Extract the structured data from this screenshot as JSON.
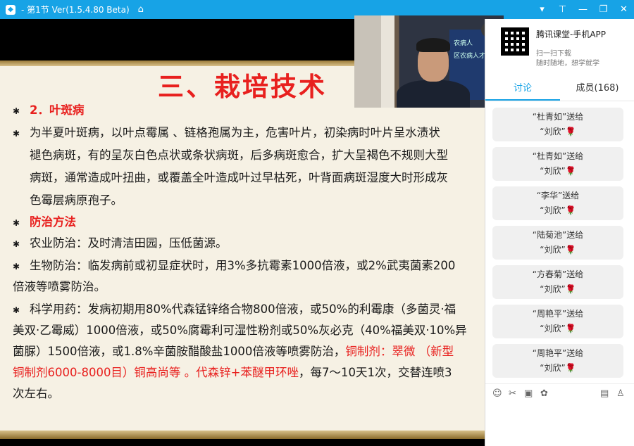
{
  "titlebar": {
    "title": "- 第1节 Ver(1.5.4.80 Beta)",
    "icons": [
      "app-icon",
      "home-icon",
      "dropdown-icon",
      "pin-icon",
      "restore-icon",
      "close-icon"
    ]
  },
  "slide": {
    "title": "三、栽培技术",
    "lines": [
      "2．叶斑病",
      "为半夏叶斑病，以叶点霉属 、链格孢属为主，危害叶片，初染病时叶片呈水渍状",
      "褪色病斑，有的呈灰白色点状或条状病斑，后多病斑愈合，扩大呈褐色不规则大型",
      "病斑，通常造成叶扭曲，或覆盖全叶造成叶过早枯死，叶背面病斑湿度大时形成灰",
      "色霉层病原孢子。",
      "防治方法",
      "农业防治：及时清洁田园，压低菌源。",
      "生物防治：临发病前或初显症状时，用3%多抗霉素1000倍液，或2%武夷菌素200",
      "倍液等喷雾防治。",
      "科学用药：发病初期用80%代森锰锌络合物800倍液，或50%的利霉康（多菌灵·福",
      "美双·乙霉威）1000倍液，或50%腐霉利可湿性粉剂或50%灰必克（40%福美双·10%异",
      "菌脲）1500倍液，或1.8%辛菌胺醋酸盐1000倍液等喷雾防治，",
      "铜制剂：翠微 （新型",
      "铜制剂6000-8000目）铜高尚等 。代森锌+苯醚甲环唑",
      "，每7～10天1次，交替连喷3",
      "次左右。"
    ]
  },
  "video": {
    "screen_text": [
      "农病人",
      "区农病人才"
    ]
  },
  "panel": {
    "promo_title": "腾讯课堂-手机APP",
    "promo_sub1": "扫一扫下载",
    "promo_sub2": "随时随地，想学就学",
    "tab_discuss": "讨论",
    "tab_members": "成员(168)",
    "messages": [
      {
        "line1": "“杜青如”送给",
        "line2": "“刘欣”"
      },
      {
        "line1": "“杜青如”送给",
        "line2": "“刘欣”"
      },
      {
        "line1": "“李华”送给",
        "line2": "“刘欣”"
      },
      {
        "line1": "“陆菊池”送给",
        "line2": "“刘欣”"
      },
      {
        "line1": "“方春菊”送给",
        "line2": "“刘欣”"
      },
      {
        "line1": "“周艳平”送给",
        "line2": "“刘欣”"
      },
      {
        "line1": "“周艳平”送给",
        "line2": "“刘欣”"
      }
    ]
  },
  "colors": {
    "accent": "#17a3e6",
    "slide_title": "#e8201e",
    "slide_bg": "#f6f1e4"
  }
}
